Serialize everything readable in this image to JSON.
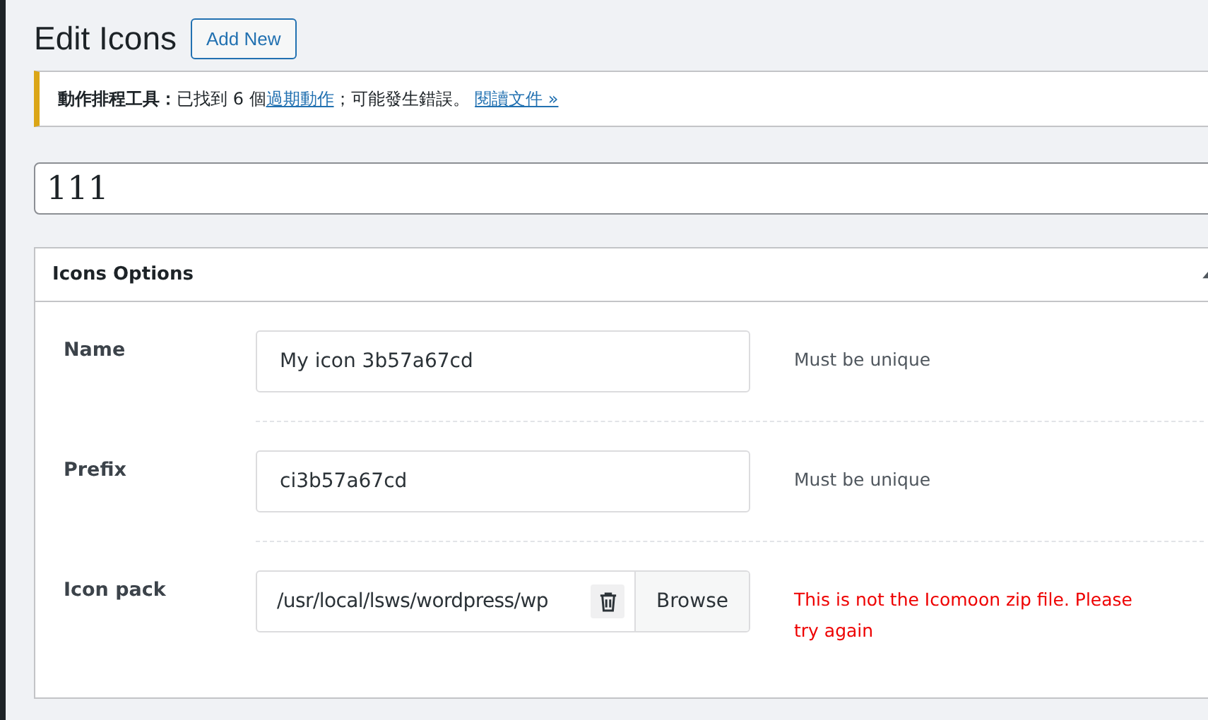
{
  "heading": {
    "title": "Edit Icons",
    "add_button": "Add New"
  },
  "notice": {
    "parts": [
      {
        "kind": "bold",
        "text": "動作排程工具："
      },
      {
        "kind": "text",
        "text": "已找到 6 個"
      },
      {
        "kind": "link",
        "text": "過期動作"
      },
      {
        "kind": "text",
        "text": "；可能發生錯誤。 "
      },
      {
        "kind": "link",
        "text": "閱讀文件 »"
      }
    ]
  },
  "title_field": {
    "value": "111"
  },
  "panel": {
    "title": "Icons Options",
    "expanded": true,
    "rows": [
      {
        "kind": "text",
        "label": "Name",
        "value": "My icon 3b57a67cd",
        "hint": "Must be unique",
        "error": false
      },
      {
        "kind": "text",
        "label": "Prefix",
        "value": "ci3b57a67cd",
        "hint": "Must be unique",
        "error": false
      },
      {
        "kind": "file",
        "label": "Icon pack",
        "value": "/usr/local/lsws/wordpress/wp",
        "button": "Browse",
        "hint": "This is not the Icomoon zip file. Please try again",
        "error": true
      }
    ]
  }
}
